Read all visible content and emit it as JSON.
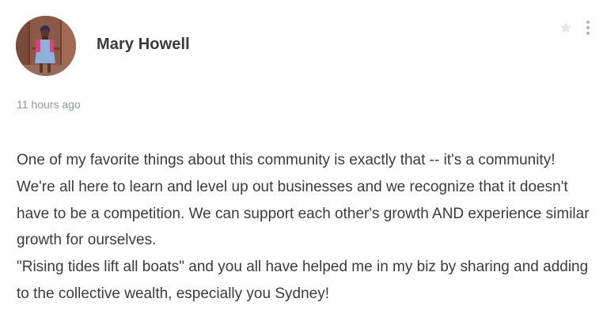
{
  "post": {
    "author": {
      "name": "Mary Howell",
      "avatar_alt": "profile photo"
    },
    "timestamp": "11 hours ago",
    "paragraphs": [
      "One of my favorite things about this community is exactly that -- it's a community! We're all here to learn and level up out businesses and we recognize that it doesn't have to be a competition. We can support each other's growth AND experience similar growth for ourselves.",
      "\"Rising tides lift all boats\" and you all have helped me in my biz by sharing and adding to the collective wealth, especially you Sydney!"
    ],
    "actions": {
      "star_icon": "star-icon",
      "more_icon": "more-vertical-icon"
    }
  },
  "colors": {
    "name_text": "#3a3a3a",
    "body_text": "#3b3b3b",
    "timestamp_text": "#8f959c",
    "icon_gray": "#c8c8c8"
  }
}
